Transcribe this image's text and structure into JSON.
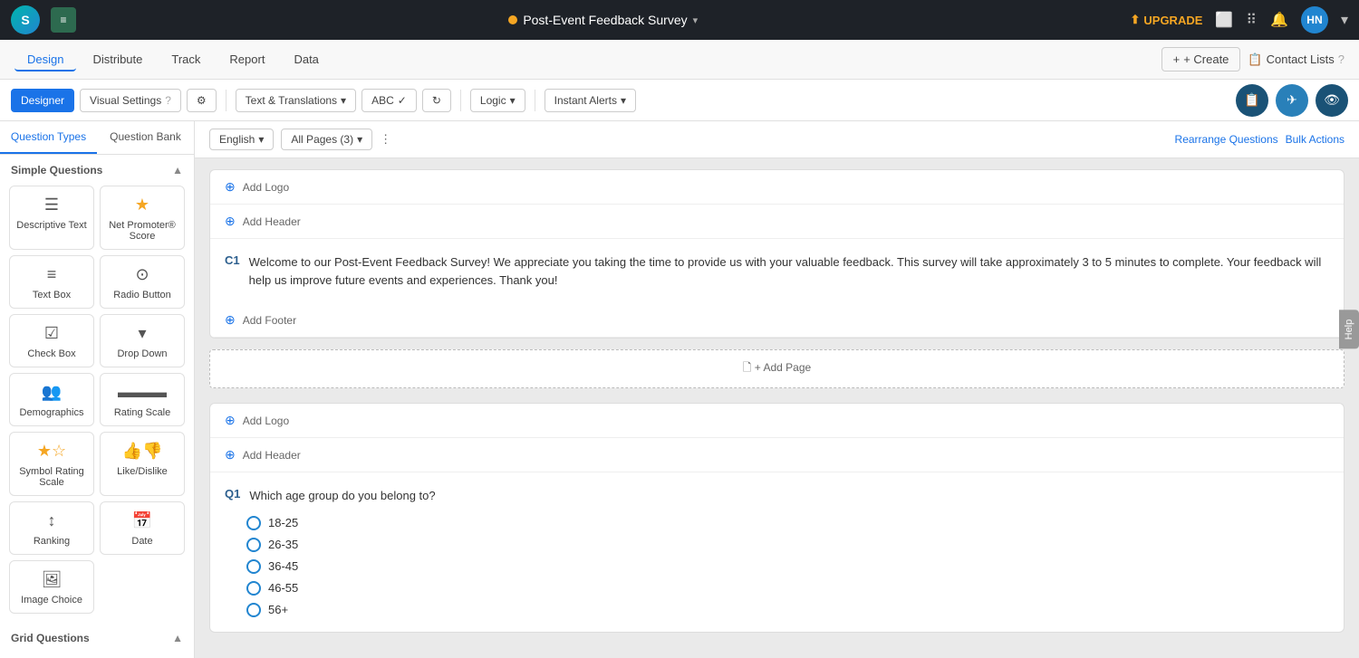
{
  "topbar": {
    "logo_text": "S",
    "icon_text": "≡",
    "survey_title": "Post-Event Feedback Survey",
    "upgrade_label": "UPGRADE",
    "avatar_initials": "HN"
  },
  "second_nav": {
    "tabs": [
      "Design",
      "Distribute",
      "Track",
      "Report",
      "Data"
    ],
    "active_tab": "Design",
    "create_label": "+ Create",
    "contact_lists_label": "Contact Lists"
  },
  "toolbar": {
    "designer_label": "Designer",
    "visual_settings_label": "Visual Settings",
    "gear_label": "⚙",
    "text_translations_label": "Text & Translations",
    "abc_label": "ABC",
    "refresh_label": "↻",
    "logic_label": "Logic",
    "instant_alerts_label": "Instant Alerts"
  },
  "left_panel": {
    "tab1": "Question Types",
    "tab2": "Question Bank",
    "simple_section": "Simple Questions",
    "question_types": [
      {
        "icon": "☰",
        "label": "Descriptive Text",
        "icon_type": "normal"
      },
      {
        "icon": "★",
        "label": "Net Promoter® Score",
        "icon_type": "orange"
      },
      {
        "icon": "≡",
        "label": "Text Box",
        "icon_type": "normal"
      },
      {
        "icon": "⊙",
        "label": "Radio Button",
        "icon_type": "normal"
      },
      {
        "icon": "☑",
        "label": "Check Box",
        "icon_type": "normal"
      },
      {
        "icon": "▾",
        "label": "Drop Down",
        "icon_type": "normal"
      },
      {
        "icon": "👥",
        "label": "Demographics",
        "icon_type": "normal"
      },
      {
        "icon": "▬",
        "label": "Rating Scale",
        "icon_type": "normal"
      },
      {
        "icon": "★",
        "label": "Symbol Rating Scale",
        "icon_type": "orange"
      },
      {
        "icon": "👍",
        "label": "Like/Dislike",
        "icon_type": "normal"
      },
      {
        "icon": "≡",
        "label": "Ranking",
        "icon_type": "normal"
      },
      {
        "icon": "📅",
        "label": "Date",
        "icon_type": "normal"
      },
      {
        "icon": "🖼",
        "label": "Image Choice",
        "icon_type": "normal"
      }
    ],
    "grid_section": "Grid Questions"
  },
  "content_toolbar": {
    "language_label": "English",
    "pages_label": "All Pages (3)",
    "rearrange_label": "Rearrange Questions",
    "bulk_label": "Bulk Actions"
  },
  "survey_cards": [
    {
      "type": "cover",
      "add_logo": "Add Logo",
      "add_header": "Add Header",
      "question_id": "C1",
      "question_text": "Welcome to our Post-Event Feedback Survey! We appreciate you taking the time to provide us with your valuable feedback. This survey will take approximately 3 to 5 minutes to complete. Your feedback will help us improve future events and experiences. Thank you!",
      "add_footer": "Add Footer"
    },
    {
      "type": "page",
      "add_logo": "Add Logo",
      "add_header": "Add Header",
      "question_id": "Q1",
      "question_text": "Which age group do you belong to?",
      "options": [
        "18-25",
        "26-35",
        "36-45",
        "46-55",
        "56+"
      ]
    }
  ],
  "add_page_label": "+ Add Page",
  "help_label": "Help"
}
